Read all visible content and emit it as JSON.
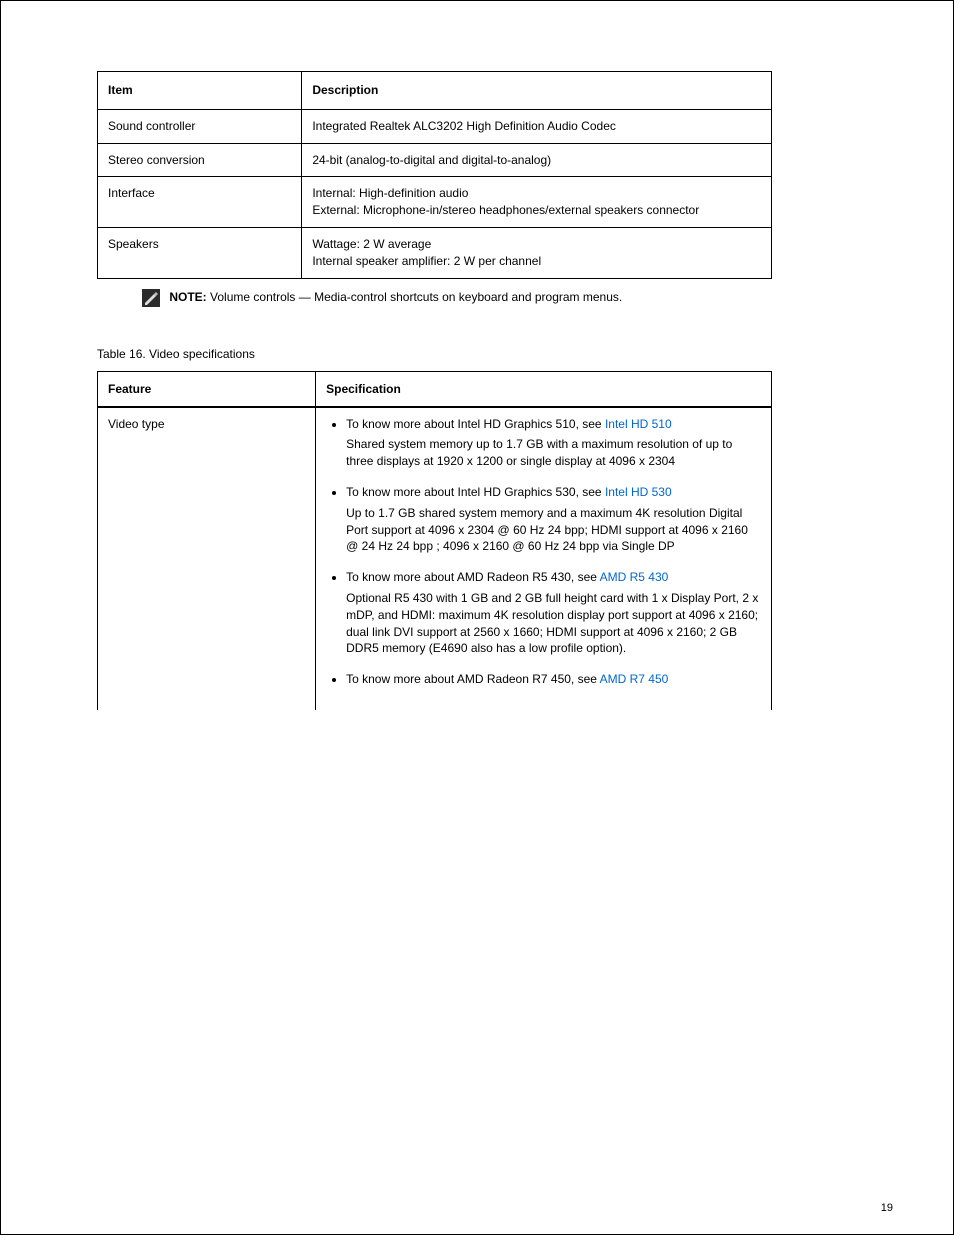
{
  "table1": {
    "header": {
      "label": "Item",
      "desc": "Description"
    },
    "rows": [
      {
        "label": "Sound controller",
        "desc": "Integrated Realtek ALC3202 High Definition Audio Codec"
      },
      {
        "label": "Stereo conversion",
        "desc": "24-bit (analog-to-digital and digital-to-analog)"
      },
      {
        "label": "Interface",
        "desc_lines": [
          "Internal: High-definition audio",
          "External: Microphone-in/stereo headphones/external speakers connector"
        ]
      },
      {
        "label": "Speakers",
        "desc_lines": [
          "Wattage: 2 W average",
          "Internal speaker amplifier: 2 W per channel"
        ]
      }
    ]
  },
  "note": {
    "label": "NOTE:",
    "text": "Volume controls — Media-control shortcuts on keyboard and program menus."
  },
  "table2": {
    "title": "Table 16. Video specifications",
    "header": {
      "feature": "Feature",
      "spec": "Specification"
    },
    "row_label": "Video type",
    "bullets": [
      {
        "title": "To know more about Intel HD Graphics 510, see",
        "linkish": "Intel HD 510",
        "para": "Shared system memory up to 1.7 GB with a maximum resolution of up to three displays at 1920 x 1200 or single display at 4096 x 2304"
      },
      {
        "title": "To know more about Intel HD Graphics 530, see",
        "linkish": "Intel HD 530",
        "para": "Up to 1.7 GB shared system memory and a maximum 4K resolution Digital Port support at 4096 x 2304 @ 60 Hz 24 bpp; HDMI support at 4096 x 2160 @ 24 Hz 24 bpp ; 4096 x 2160 @ 60 Hz 24 bpp via Single DP"
      },
      {
        "title": "To know more about AMD Radeon R5 430, see",
        "linkish": "AMD R5 430",
        "para": "Optional R5 430 with 1 GB and 2 GB full height card with 1 x Display Port, 2 x mDP, and HDMI: maximum 4K resolution display port support at 4096 x 2160; dual link DVI support at 2560 x 1660; HDMI support at 4096 x 2160; 2 GB DDR5 memory (E4690 also has a low profile option)."
      },
      {
        "title": "To know more about AMD Radeon R7 450, see",
        "linkish": "AMD R7 450",
        "para": ""
      }
    ]
  },
  "footer": "19"
}
